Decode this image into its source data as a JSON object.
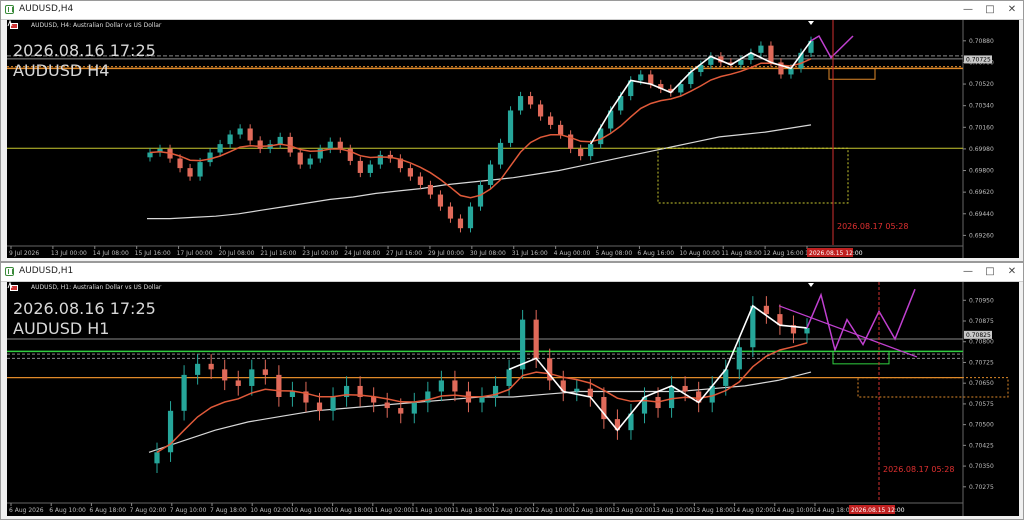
{
  "windows": [
    {
      "title": "AUDUSD,H4",
      "description": "AUDUSD, H4:  Australian Dollar vs US Dollar",
      "overlay_date": "2026.08.16 17:25",
      "overlay_symbol": "AUDUSD H4",
      "vline_label": "2026.08.17 05:28",
      "time_label": "2026.08.15 12:00",
      "buttons": [
        "—",
        "□",
        "✕"
      ]
    },
    {
      "title": "AUDUSD,H1",
      "description": "AUDUSD, H1:  Australian Dollar vs US Dollar",
      "overlay_date": "2026.08.16 17:25",
      "overlay_symbol": "AUDUSD H1",
      "vline_label": "2026.08.17 05:28",
      "time_label": "2026.08.15 12:00",
      "buttons": [
        "—",
        "□",
        "✕"
      ]
    }
  ],
  "chart_data": [
    {
      "type": "line",
      "title": "AUDUSD, H4:  Australian Dollar vs US Dollar",
      "y_ticks": [
        "0.70880",
        "0.70700",
        "0.70520",
        "0.70340",
        "0.70160",
        "0.69980",
        "0.69800",
        "0.69620",
        "0.69440",
        "0.69260"
      ],
      "current_price": "0.70725",
      "x_ticks": [
        "9 Jul 2026",
        "13 Jul 00:00",
        "14 Jul 08:00",
        "15 Jul 16:00",
        "17 Jul 00:00",
        "20 Jul 08:00",
        "21 Jul 16:00",
        "23 Jul 00:00",
        "24 Jul 08:00",
        "27 Jul 16:00",
        "29 Jul 00:00",
        "30 Jul 08:00",
        "31 Jul 16:00",
        "4 Aug 00:00",
        "5 Aug 08:00",
        "6 Aug 16:00",
        "10 Aug 00:00",
        "11 Aug 08:00",
        "12 Aug 16:00",
        "14 Aug"
      ],
      "ylim": [
        0.6918,
        0.7097
      ],
      "close": [
        0.6995,
        0.6998,
        0.699,
        0.6982,
        0.6975,
        0.6987,
        0.6995,
        0.7002,
        0.701,
        0.7015,
        0.7005,
        0.6998,
        0.7002,
        0.7008,
        0.6995,
        0.6985,
        0.699,
        0.6998,
        0.7004,
        0.6998,
        0.6988,
        0.6978,
        0.6985,
        0.6993,
        0.699,
        0.6982,
        0.6975,
        0.6968,
        0.696,
        0.695,
        0.694,
        0.6932,
        0.695,
        0.6968,
        0.6985,
        0.7003,
        0.703,
        0.7042,
        0.7035,
        0.7025,
        0.7018,
        0.701,
        0.6998,
        0.6992,
        0.7002,
        0.7015,
        0.703,
        0.7042,
        0.7055,
        0.706,
        0.7052,
        0.7048,
        0.7045,
        0.7052,
        0.7062,
        0.7068,
        0.7075,
        0.707,
        0.7068,
        0.7072,
        0.7078,
        0.7084,
        0.707,
        0.706,
        0.7065,
        0.7078,
        0.7088
      ],
      "ma_slow": [
        0.694,
        0.694,
        0.6941,
        0.6942,
        0.6944,
        0.6947,
        0.695,
        0.6953,
        0.6956,
        0.6958,
        0.6961,
        0.6963,
        0.6965,
        0.6968,
        0.697,
        0.6972,
        0.6974,
        0.6977,
        0.698,
        0.6984,
        0.6988,
        0.6992,
        0.6996,
        0.7,
        0.7004,
        0.7008,
        0.701,
        0.7012,
        0.7015,
        0.7018
      ]
    },
    {
      "type": "line",
      "title": "AUDUSD, H1:  Australian Dollar vs US Dollar",
      "y_ticks": [
        "0.70950",
        "0.70875",
        "0.70800",
        "0.70725",
        "0.70650",
        "0.70575",
        "0.70500",
        "0.70425",
        "0.70350",
        "0.70275"
      ],
      "current_price": "0.70825",
      "x_ticks": [
        "6 Aug 2026",
        "6 Aug 10:00",
        "6 Aug 18:00",
        "7 Aug 02:00",
        "7 Aug 10:00",
        "7 Aug 18:00",
        "10 Aug 02:00",
        "10 Aug 10:00",
        "10 Aug 18:00",
        "11 Aug 02:00",
        "11 Aug 10:00",
        "11 Aug 18:00",
        "12 Aug 02:00",
        "12 Aug 10:00",
        "12 Aug 18:00",
        "13 Aug 02:00",
        "13 Aug 10:00",
        "13 Aug 18:00",
        "14 Aug 02:00",
        "14 Aug 10:00",
        "14 Aug 18:00"
      ],
      "ylim": [
        0.7022,
        0.7098
      ],
      "close": [
        0.704,
        0.7055,
        0.7068,
        0.7072,
        0.707,
        0.7066,
        0.7064,
        0.707,
        0.7068,
        0.706,
        0.7062,
        0.7058,
        0.7055,
        0.706,
        0.7064,
        0.706,
        0.7058,
        0.7056,
        0.7054,
        0.7058,
        0.7062,
        0.7066,
        0.7062,
        0.7058,
        0.706,
        0.7064,
        0.707,
        0.7088,
        0.7074,
        0.7066,
        0.7062,
        0.7063,
        0.706,
        0.7052,
        0.7048,
        0.7054,
        0.706,
        0.7056,
        0.7064,
        0.7062,
        0.7058,
        0.7064,
        0.707,
        0.7078,
        0.7093,
        0.709,
        0.7086,
        0.7083,
        0.7085
      ],
      "ma_slow": [
        0.704,
        0.7044,
        0.7048,
        0.7051,
        0.7053,
        0.7055,
        0.7056,
        0.7057,
        0.7058,
        0.7059,
        0.706,
        0.706,
        0.7061,
        0.7062,
        0.7062,
        0.7062,
        0.7062,
        0.7063,
        0.7064,
        0.7066,
        0.7069
      ]
    }
  ]
}
